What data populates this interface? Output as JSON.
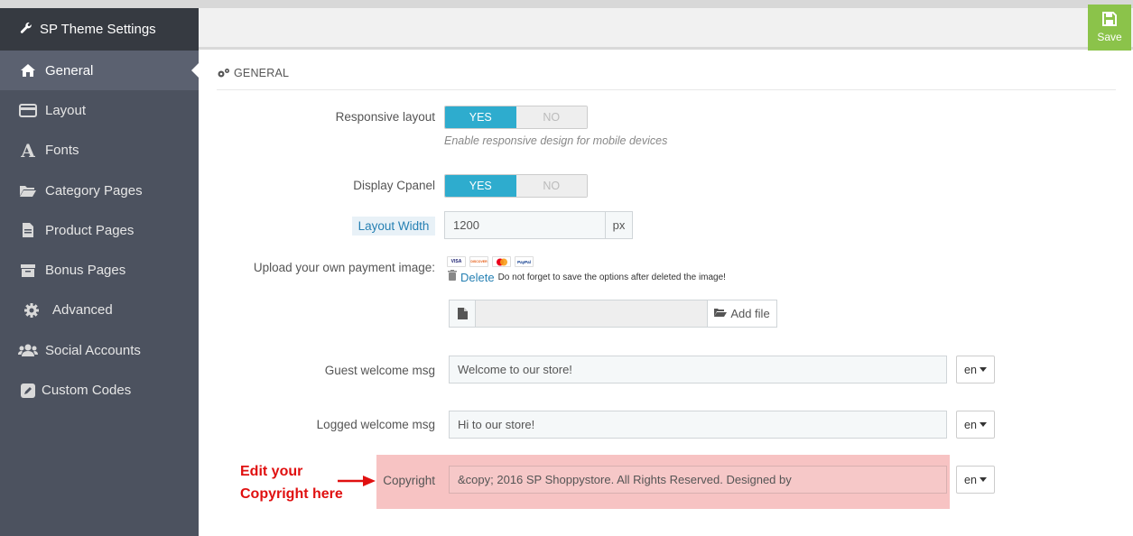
{
  "sidebar": {
    "title": "SP Theme Settings",
    "items": [
      {
        "label": "General",
        "icon": "home-icon",
        "active": true
      },
      {
        "label": "Layout",
        "icon": "layout-icon"
      },
      {
        "label": "Fonts",
        "icon": "font-icon"
      },
      {
        "label": "Category Pages",
        "icon": "folder-open-icon"
      },
      {
        "label": "Product Pages",
        "icon": "file-icon"
      },
      {
        "label": "Bonus Pages",
        "icon": "archive-icon"
      },
      {
        "label": "Advanced",
        "icon": "gear-icon"
      },
      {
        "label": "Social Accounts",
        "icon": "users-icon"
      },
      {
        "label": "Custom Codes",
        "icon": "edit-icon"
      }
    ]
  },
  "toolbar": {
    "save_label": "Save"
  },
  "section": {
    "title": "GENERAL"
  },
  "form": {
    "responsive_layout": {
      "label": "Responsive layout",
      "yes": "YES",
      "no": "NO",
      "help": "Enable responsive design for mobile devices"
    },
    "display_cpanel": {
      "label": "Display Cpanel",
      "yes": "YES",
      "no": "NO"
    },
    "layout_width": {
      "label": "Layout Width",
      "value": "1200",
      "unit": "px"
    },
    "payment_image": {
      "label": "Upload your own payment image:",
      "cards": [
        "VISA",
        "DISCOVER",
        "MC",
        "PayPal"
      ],
      "delete_label": "Delete",
      "delete_note": "Do not forget to save the options after deleted the image!",
      "add_file_label": "Add file"
    },
    "guest_welcome": {
      "label": "Guest welcome msg",
      "value": "Welcome to our store!",
      "lang": "en"
    },
    "logged_welcome": {
      "label": "Logged welcome msg",
      "value": "Hi to our store!",
      "lang": "en"
    },
    "copyright": {
      "label": "Copyright",
      "value": "&copy; 2016 SP Shoppystore. All Rights Reserved. Designed by",
      "lang": "en"
    }
  },
  "annotation": {
    "line1": "Edit your",
    "line2": "Copyright here"
  },
  "colors": {
    "accent": "#2eacce",
    "save": "#8bc34a",
    "highlight": "#f7c3c3",
    "annotation": "#e01010"
  }
}
